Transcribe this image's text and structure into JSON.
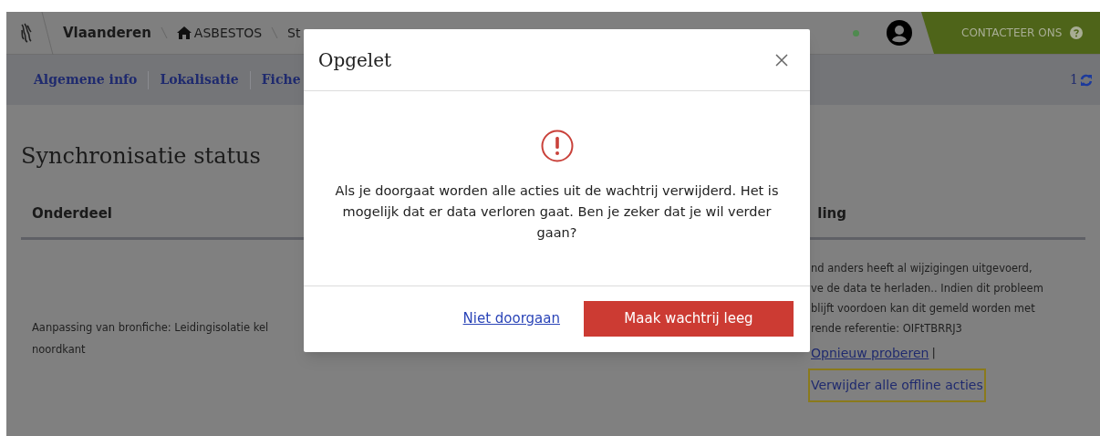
{
  "header": {
    "brand": "Vlaanderen",
    "breadcrumbs": [
      {
        "label": "ASBESTOS",
        "kind": "home"
      },
      {
        "label": "St",
        "kind": "plain"
      }
    ],
    "contact": "CONTACTEER ONS"
  },
  "nav": {
    "tabs": [
      "Algemene info",
      "Lokalisatie",
      "Fiche"
    ],
    "count": "1"
  },
  "page": {
    "title": "Synchronisatie status",
    "columns": [
      "Onderdeel",
      "ling"
    ],
    "rows": [
      {
        "part_lines": [
          "Aanpassing van bronfiche: Leidingisolatie kel",
          "noordkant"
        ],
        "message_lines": [
          "nd anders heeft al wijzigingen uitgevoerd,",
          "ve de data te herladen.. Indien dit probleem",
          "blijft voordoen kan dit gemeld worden met",
          "rende referentie: OIFtTBRRJ3"
        ],
        "actions": [
          {
            "label": "Opnieuw proberen",
            "focused": false,
            "separator": "|"
          },
          {
            "label": "Verwijder alle offline acties",
            "focused": true
          }
        ]
      }
    ]
  },
  "dialog": {
    "title": "Opgelet",
    "message": "Als je doorgaat worden alle acties uit de wachtrij verwijderd. Het is mogelijk dat er data verloren gaat. Ben je zeker dat je wil verder gaan?",
    "buttons": [
      {
        "label": "Niet doorgaan",
        "kind": "link"
      },
      {
        "label": "Maak wachtrij leeg",
        "kind": "primary"
      }
    ]
  }
}
